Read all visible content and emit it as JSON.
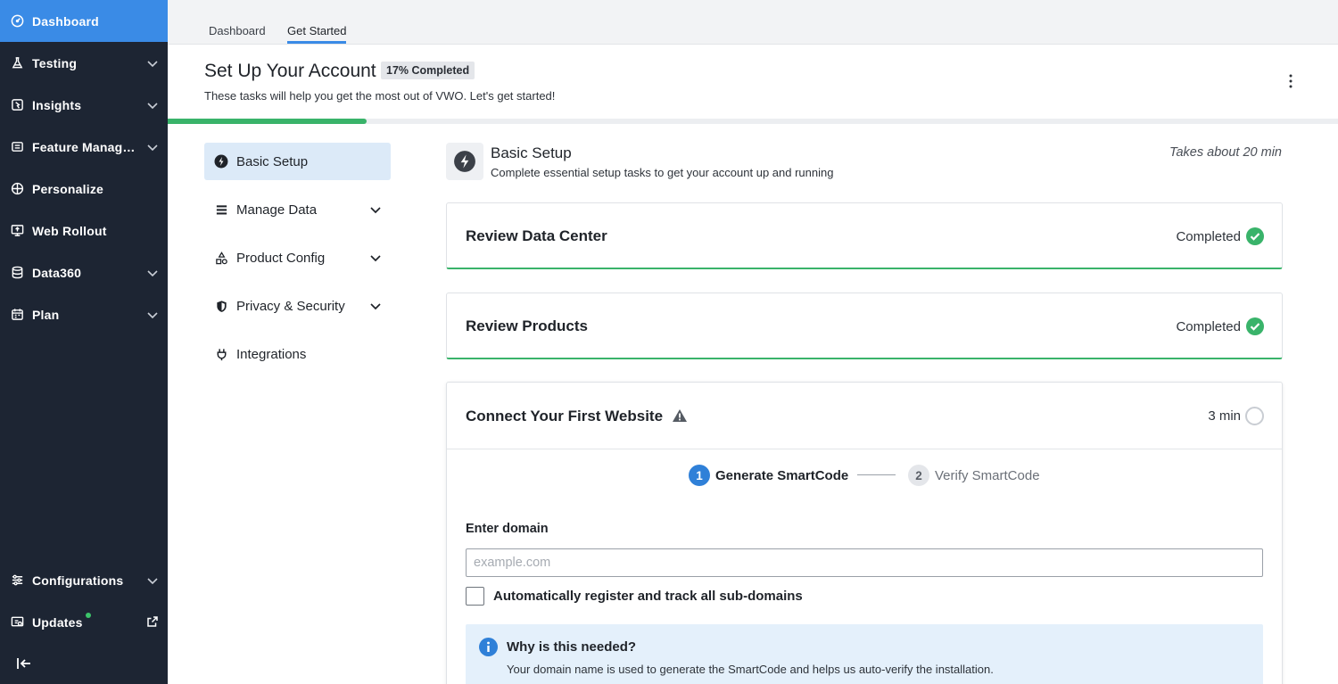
{
  "sidebar": {
    "items": [
      {
        "label": "Dashboard",
        "icon": "gauge-icon"
      },
      {
        "label": "Testing",
        "icon": "flask-icon"
      },
      {
        "label": "Insights",
        "icon": "insights-icon"
      },
      {
        "label": "Feature Management",
        "icon": "feature-icon"
      },
      {
        "label": "Personalize",
        "icon": "target-icon"
      },
      {
        "label": "Web Rollout",
        "icon": "rollout-icon"
      },
      {
        "label": "Data360",
        "icon": "database-icon"
      },
      {
        "label": "Plan",
        "icon": "calendar-icon"
      }
    ],
    "bottom": [
      {
        "label": "Configurations",
        "icon": "sliders-icon"
      },
      {
        "label": "Updates",
        "icon": "updates-icon"
      }
    ]
  },
  "tabs": [
    "Dashboard",
    "Get Started"
  ],
  "header": {
    "title": "Set Up Your Account",
    "badge": "17% Completed",
    "subtitle": "These tasks will help you get the most out of VWO. Let's get started!",
    "progress_fraction": 0.17
  },
  "subnav": [
    {
      "label": "Basic Setup",
      "icon": "bolt-icon"
    },
    {
      "label": "Manage Data",
      "icon": "list-icon"
    },
    {
      "label": "Product Config",
      "icon": "shapes-icon"
    },
    {
      "label": "Privacy & Security",
      "icon": "shield-icon"
    },
    {
      "label": "Integrations",
      "icon": "plug-icon"
    }
  ],
  "section": {
    "title": "Basic Setup",
    "subtitle": "Complete essential setup tasks to get your account up and running",
    "time": "Takes about 20 min"
  },
  "tasks": [
    {
      "title": "Review Data Center",
      "status": "Completed"
    },
    {
      "title": "Review Products",
      "status": "Completed"
    },
    {
      "title": "Connect Your First Website",
      "status": "3 min"
    }
  ],
  "steps": [
    {
      "num": "1",
      "label": "Generate SmartCode"
    },
    {
      "num": "2",
      "label": "Verify SmartCode"
    }
  ],
  "form": {
    "domain_label": "Enter domain",
    "domain_placeholder": "example.com",
    "domain_value": "",
    "subdomain_label": "Automatically register and track all sub-domains"
  },
  "info": {
    "title": "Why is this needed?",
    "text": "Your domain name is used to generate the SmartCode and helps us auto-verify the installation."
  },
  "colors": {
    "sidebar_bg": "#1d2533",
    "accent": "#3a8be6",
    "success": "#39b36a",
    "info_bg": "#e4f0fb"
  }
}
